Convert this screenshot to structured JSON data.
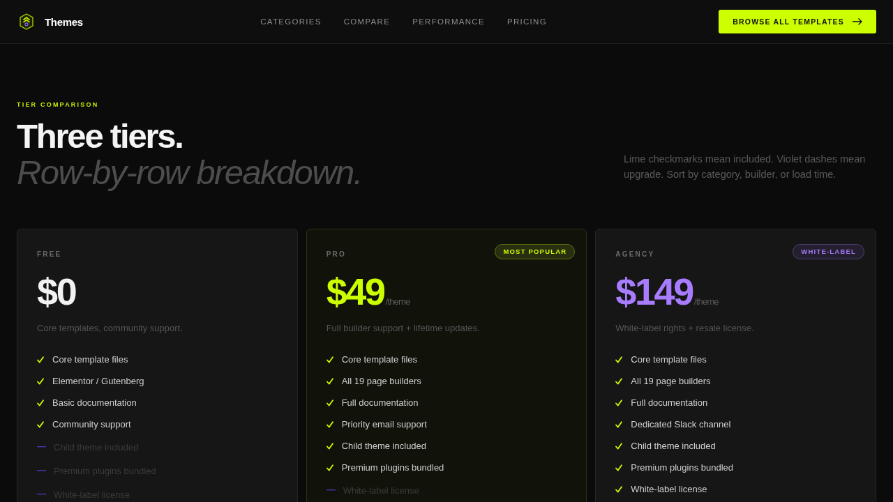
{
  "header": {
    "brand": "Themes",
    "nav": [
      "CATEGORIES",
      "COMPARE",
      "PERFORMANCE",
      "PRICING"
    ],
    "cta": "BROWSE ALL TEMPLATES"
  },
  "hero": {
    "eyebrow": "TIER COMPARISON",
    "title": "Three tiers.",
    "subtitle": "Row-by-row breakdown.",
    "note": "Lime checkmarks mean included. Violet dashes mean upgrade. Sort by category, builder, or load time."
  },
  "tiers": [
    {
      "name": "FREE",
      "price": "$0",
      "color": "#f2f2f2",
      "featured": false,
      "description": "Core templates, community support.",
      "features": [
        {
          "text": "Core template files",
          "included": true
        },
        {
          "text": "Elementor / Gutenberg",
          "included": true
        },
        {
          "text": "Basic documentation",
          "included": true
        },
        {
          "text": "Community support",
          "included": true
        },
        {
          "text": "Child theme included",
          "included": false
        },
        {
          "text": "Premium plugins bundled",
          "included": false
        },
        {
          "text": "White-label license",
          "included": false
        }
      ]
    },
    {
      "name": "PRO",
      "badge": "MOST POPULAR",
      "price": "$49",
      "unit": "/theme",
      "color": "#ccff00",
      "featured": true,
      "description": "Full builder support + lifetime updates.",
      "features": [
        {
          "text": "Core template files",
          "included": true
        },
        {
          "text": "All 19 page builders",
          "included": true
        },
        {
          "text": "Full documentation",
          "included": true
        },
        {
          "text": "Priority email support",
          "included": true
        },
        {
          "text": "Child theme included",
          "included": true
        },
        {
          "text": "Premium plugins bundled",
          "included": true
        },
        {
          "text": "White-label license",
          "included": false
        }
      ]
    },
    {
      "name": "AGENCY",
      "badge": "WHITE-LABEL",
      "price": "$149",
      "unit": "/theme",
      "color": "#a87cff",
      "featured": false,
      "description": "White-label rights + resale license.",
      "features": [
        {
          "text": "Core template files",
          "included": true
        },
        {
          "text": "All 19 page builders",
          "included": true
        },
        {
          "text": "Full documentation",
          "included": true
        },
        {
          "text": "Dedicated Slack channel",
          "included": true
        },
        {
          "text": "Child theme included",
          "included": true
        },
        {
          "text": "Premium plugins bundled",
          "included": true
        },
        {
          "text": "White-label license",
          "included": true
        }
      ]
    }
  ]
}
